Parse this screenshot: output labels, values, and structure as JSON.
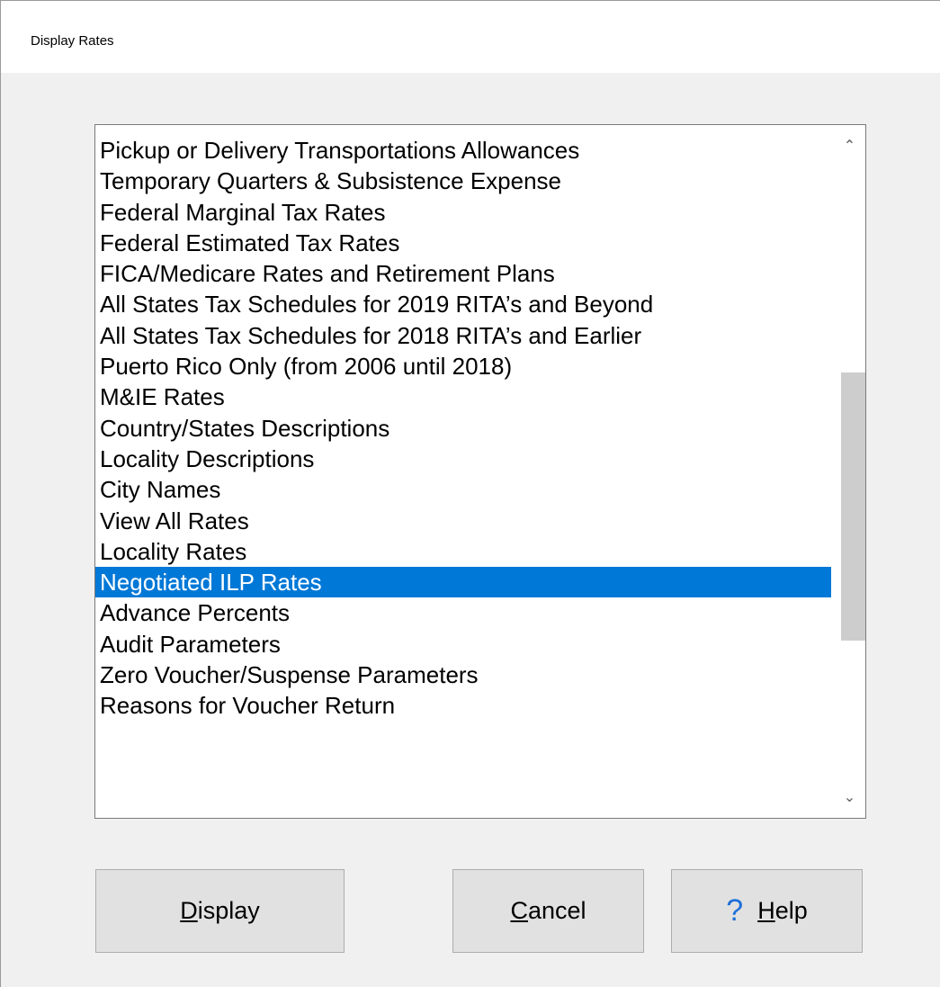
{
  "window": {
    "title": "Display Rates"
  },
  "list": {
    "items": [
      "Pickup or Delivery Transportations Allowances",
      "Temporary Quarters & Subsistence Expense",
      "Federal Marginal Tax Rates",
      "Federal Estimated Tax Rates",
      "FICA/Medicare Rates and Retirement Plans",
      "All States Tax Schedules for 2019 RITA’s and Beyond",
      "All States Tax Schedules for 2018 RITA’s and Earlier",
      "Puerto Rico Only (from 2006 until 2018)",
      "M&IE Rates",
      "Country/States Descriptions",
      "Locality Descriptions",
      "City Names",
      "View All Rates",
      "Locality Rates",
      "Negotiated ILP Rates",
      "Advance Percents",
      "Audit Parameters",
      "Zero Voucher/Suspense Parameters",
      "Reasons for Voucher Return"
    ],
    "selected_index": 14,
    "scroll_up_icon": "chevron-up-icon",
    "scroll_down_icon": "chevron-down-icon"
  },
  "buttons": {
    "display": {
      "mnemonic": "D",
      "rest": "isplay"
    },
    "cancel": {
      "mnemonic": "C",
      "rest": "ancel"
    },
    "help": {
      "icon": "question-mark-icon",
      "glyph": "?",
      "mnemonic": "H",
      "rest": "elp"
    }
  },
  "colors": {
    "selection": "#0078d7",
    "help_icon": "#1e6fd9",
    "button_face": "#e1e1e1"
  }
}
